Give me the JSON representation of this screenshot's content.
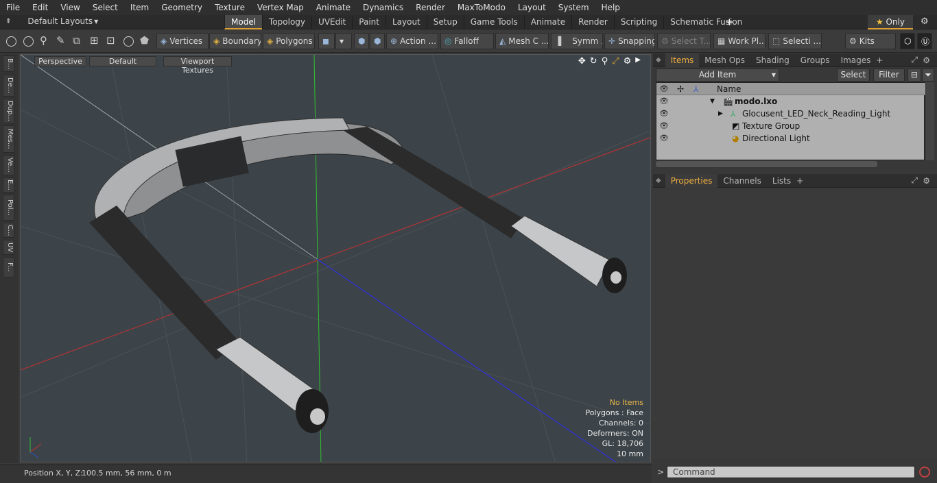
{
  "menubar": {
    "items": [
      "File",
      "Edit",
      "View",
      "Select",
      "Item",
      "Geometry",
      "Texture",
      "Vertex Map",
      "Animate",
      "Dynamics",
      "Render",
      "MaxToModo",
      "Layout",
      "System",
      "Help"
    ]
  },
  "modebar": {
    "layouts_label": "Default Layouts",
    "tabs": [
      "Model",
      "Topology",
      "UVEdit",
      "Paint",
      "Layout",
      "Setup",
      "Game Tools",
      "Animate",
      "Render",
      "Scripting",
      "Schematic Fusion"
    ],
    "active_tab": "Model",
    "only_label": "Only"
  },
  "toolbar": {
    "vertices": "Vertices",
    "boundary": "Boundary",
    "polygons": "Polygons",
    "action": "Action ...",
    "falloff": "Falloff",
    "mesh": "Mesh C ...",
    "symm": "Symm ...",
    "snapping": "Snapping",
    "select_t": "Select T...",
    "work_pl": "Work Pl...",
    "selecti": "Selecti ...",
    "kits": "Kits"
  },
  "lefttabs": [
    "B...",
    "De...",
    "Dup...",
    "Mes...",
    "Ve...",
    "E...",
    "Pol...",
    "C...",
    "UV",
    "F..."
  ],
  "viewport": {
    "perspective": "Perspective",
    "default": "Default",
    "viewport_textures": "Viewport Textures",
    "stats": {
      "no_items": "No Items",
      "polygons": "Polygons : Face",
      "channels": "Channels: 0",
      "deformers": "Deformers: ON",
      "gl": "GL: 18,706",
      "scale": "10 mm"
    }
  },
  "statusbar": {
    "position_label": "Position X, Y, Z:",
    "position_value": "100.5 mm, 56 mm, 0 m"
  },
  "items_panel": {
    "tabs": [
      "Items",
      "Mesh Ops",
      "Shading",
      "Groups",
      "Images"
    ],
    "active_tab": "Items",
    "add_item": "Add Item",
    "select": "Select",
    "filter": "Filter",
    "name_header": "Name",
    "rows": [
      {
        "label": "modo.lxo",
        "icon": "scene-icon"
      },
      {
        "label": "Glocusent_LED_Neck_Reading_Light",
        "icon": "mesh-icon"
      },
      {
        "label": "Texture Group",
        "icon": "texture-group-icon"
      },
      {
        "label": "Directional Light",
        "icon": "light-icon"
      }
    ]
  },
  "properties_panel": {
    "tabs": [
      "Properties",
      "Channels",
      "Lists"
    ],
    "active_tab": "Properties"
  },
  "command": {
    "placeholder": "Command",
    "prompt": ">"
  },
  "colors": {
    "accent": "#e0a030",
    "viewport_bg": "#3d4449",
    "axis_x": "#c83030",
    "axis_y": "#30c030",
    "axis_z": "#3030d0"
  }
}
